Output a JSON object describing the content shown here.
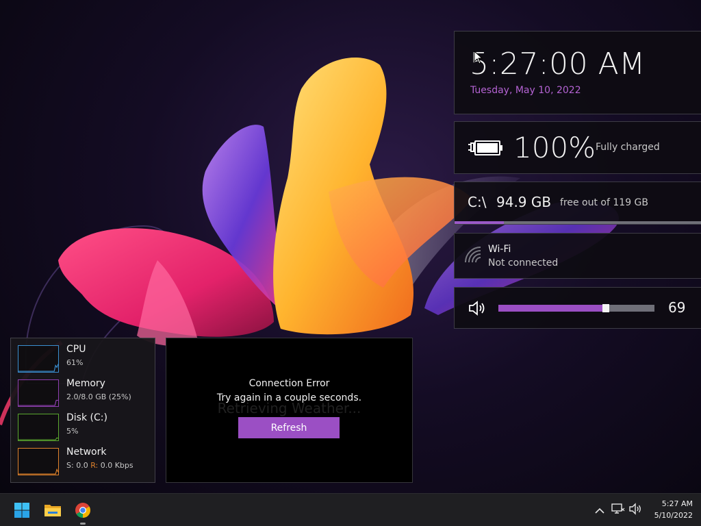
{
  "clock": {
    "time": "5:27:00 AM",
    "date": "Tuesday, May 10, 2022",
    "date_color": "#b463d3"
  },
  "battery": {
    "percent": "100%",
    "status": "Fully charged",
    "icon": "battery-charging-icon"
  },
  "disk": {
    "drive": "C:\\",
    "free": "94.9 GB",
    "description": "free out of 119 GB",
    "used_fraction": 0.2
  },
  "wifi": {
    "name": "Wi-Fi",
    "status": "Not connected",
    "icon": "wifi-icon"
  },
  "volume": {
    "value": "69",
    "level_fraction": 0.69,
    "icon": "speaker-icon"
  },
  "performance": {
    "items": [
      {
        "label": "CPU",
        "value": "61%",
        "color": "#3a8fd1",
        "fraction": 0.61
      },
      {
        "label": "Memory",
        "value": "2.0/8.0 GB (25%)",
        "color": "#8e3fb0",
        "fraction": 0.25
      },
      {
        "label": "Disk (C:)",
        "value": "5%",
        "color": "#5ba82e",
        "fraction": 0.05
      }
    ],
    "network": {
      "label": "Network",
      "send_label": "S:",
      "send_value": "0.0",
      "recv_label": "R:",
      "recv_value": "0.0 Kbps",
      "color": "#e0822b"
    }
  },
  "weather": {
    "background_text": "Retrieving Weather...",
    "error_title": "Connection Error",
    "error_message": "Try again in a couple seconds.",
    "refresh_label": "Refresh",
    "accent": "#9b4fc4"
  },
  "taskbar": {
    "pinned": [
      {
        "name": "start-button",
        "icon": "windows-logo-icon"
      },
      {
        "name": "file-explorer-button",
        "icon": "folder-icon"
      },
      {
        "name": "chrome-button",
        "icon": "chrome-icon"
      }
    ],
    "tray": {
      "time": "5:27 AM",
      "date": "5/10/2022"
    }
  }
}
